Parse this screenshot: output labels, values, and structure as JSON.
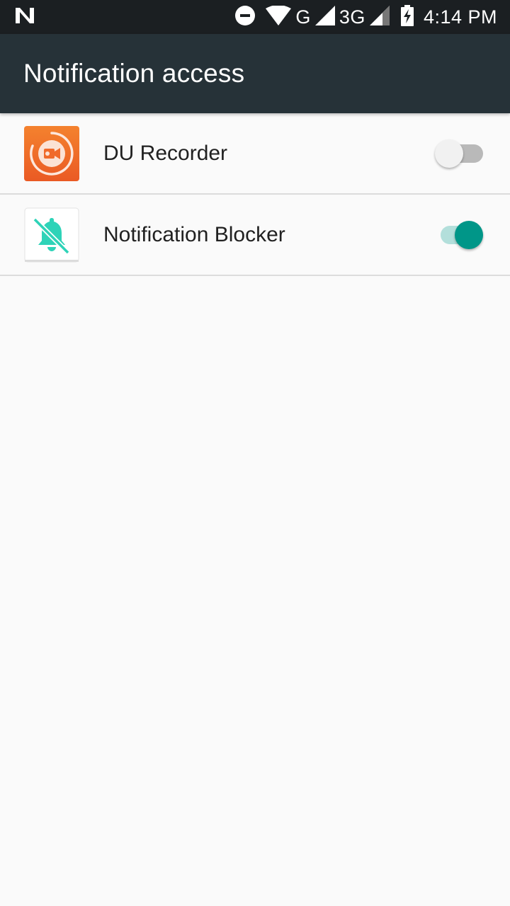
{
  "status_bar": {
    "network_type_1": "G",
    "network_type_2": "3G",
    "time": "4:14 PM",
    "icons": [
      "n-logo-icon",
      "do-not-disturb-icon",
      "wifi-icon",
      "signal-icon",
      "battery-charging-icon"
    ]
  },
  "app_bar": {
    "title": "Notification access",
    "color": "#263238"
  },
  "items": [
    {
      "label": "DU Recorder",
      "enabled": false,
      "icon": "du-recorder-app-icon"
    },
    {
      "label": "Notification Blocker",
      "enabled": true,
      "icon": "notification-blocker-app-icon"
    }
  ],
  "colors": {
    "accent": "#009688",
    "du_recorder_orange": "#f0662a",
    "blocker_teal": "#2ed3b8"
  }
}
